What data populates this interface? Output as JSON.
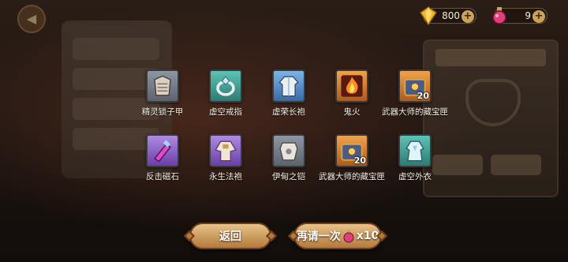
{
  "currencies": [
    {
      "name": "gem",
      "icon": "diamond-icon",
      "value": "800",
      "color": "#f2b626"
    },
    {
      "name": "potion",
      "icon": "potion-icon",
      "value": "9",
      "color": "#e0407a"
    }
  ],
  "rewards": [
    {
      "name": "精灵锁子甲",
      "icon": "chainmail-icon",
      "rarity": "grey",
      "count": ""
    },
    {
      "name": "虚空戒指",
      "icon": "ring-icon",
      "rarity": "teal",
      "count": ""
    },
    {
      "name": "虚荣长袍",
      "icon": "robe-icon",
      "rarity": "blue",
      "count": ""
    },
    {
      "name": "鬼火",
      "icon": "flame-icon",
      "rarity": "orange",
      "count": ""
    },
    {
      "name": "武器大师的藏宝匣",
      "icon": "treasure-chest-icon",
      "rarity": "orange",
      "count": "20"
    },
    {
      "name": "反击磁石",
      "icon": "magnet-stone-icon",
      "rarity": "purple",
      "count": ""
    },
    {
      "name": "永生法袍",
      "icon": "mage-robe-icon",
      "rarity": "purple",
      "count": ""
    },
    {
      "name": "伊甸之铠",
      "icon": "armor-icon",
      "rarity": "grey",
      "count": ""
    },
    {
      "name": "武器大师的藏宝匣",
      "icon": "treasure-chest-icon",
      "rarity": "orange",
      "count": "20"
    },
    {
      "name": "虚空外衣",
      "icon": "cloak-icon",
      "rarity": "teal",
      "count": ""
    }
  ],
  "buttons": {
    "back": "返回",
    "retry": "再请一次",
    "retry_cost": "x10"
  }
}
